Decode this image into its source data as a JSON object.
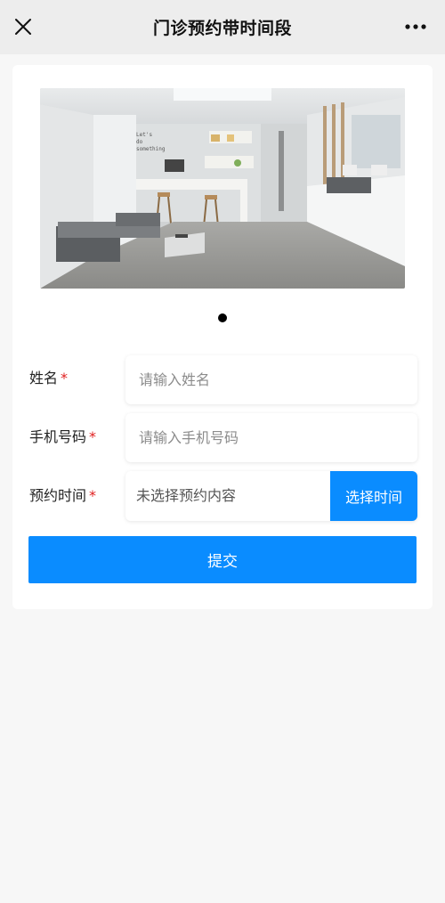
{
  "header": {
    "title": "门诊预约带时间段",
    "close_icon": "close-icon",
    "more_icon": "more-dots-icon"
  },
  "carousel": {
    "active_index": 0,
    "slide_count": 1,
    "wall_text": "Let's do something"
  },
  "form": {
    "name": {
      "label": "姓名",
      "required_mark": "*",
      "placeholder": "请输入姓名",
      "value": ""
    },
    "phone": {
      "label": "手机号码",
      "required_mark": "*",
      "placeholder": "请输入手机号码",
      "value": ""
    },
    "time": {
      "label": "预约时间",
      "required_mark": "*",
      "value_text": "未选择预约内容",
      "button_label": "选择时间"
    },
    "submit_label": "提交"
  },
  "colors": {
    "accent": "#0a8cff",
    "required": "#e02020",
    "header_bg": "#ededed",
    "page_bg": "#f7f7f7"
  }
}
